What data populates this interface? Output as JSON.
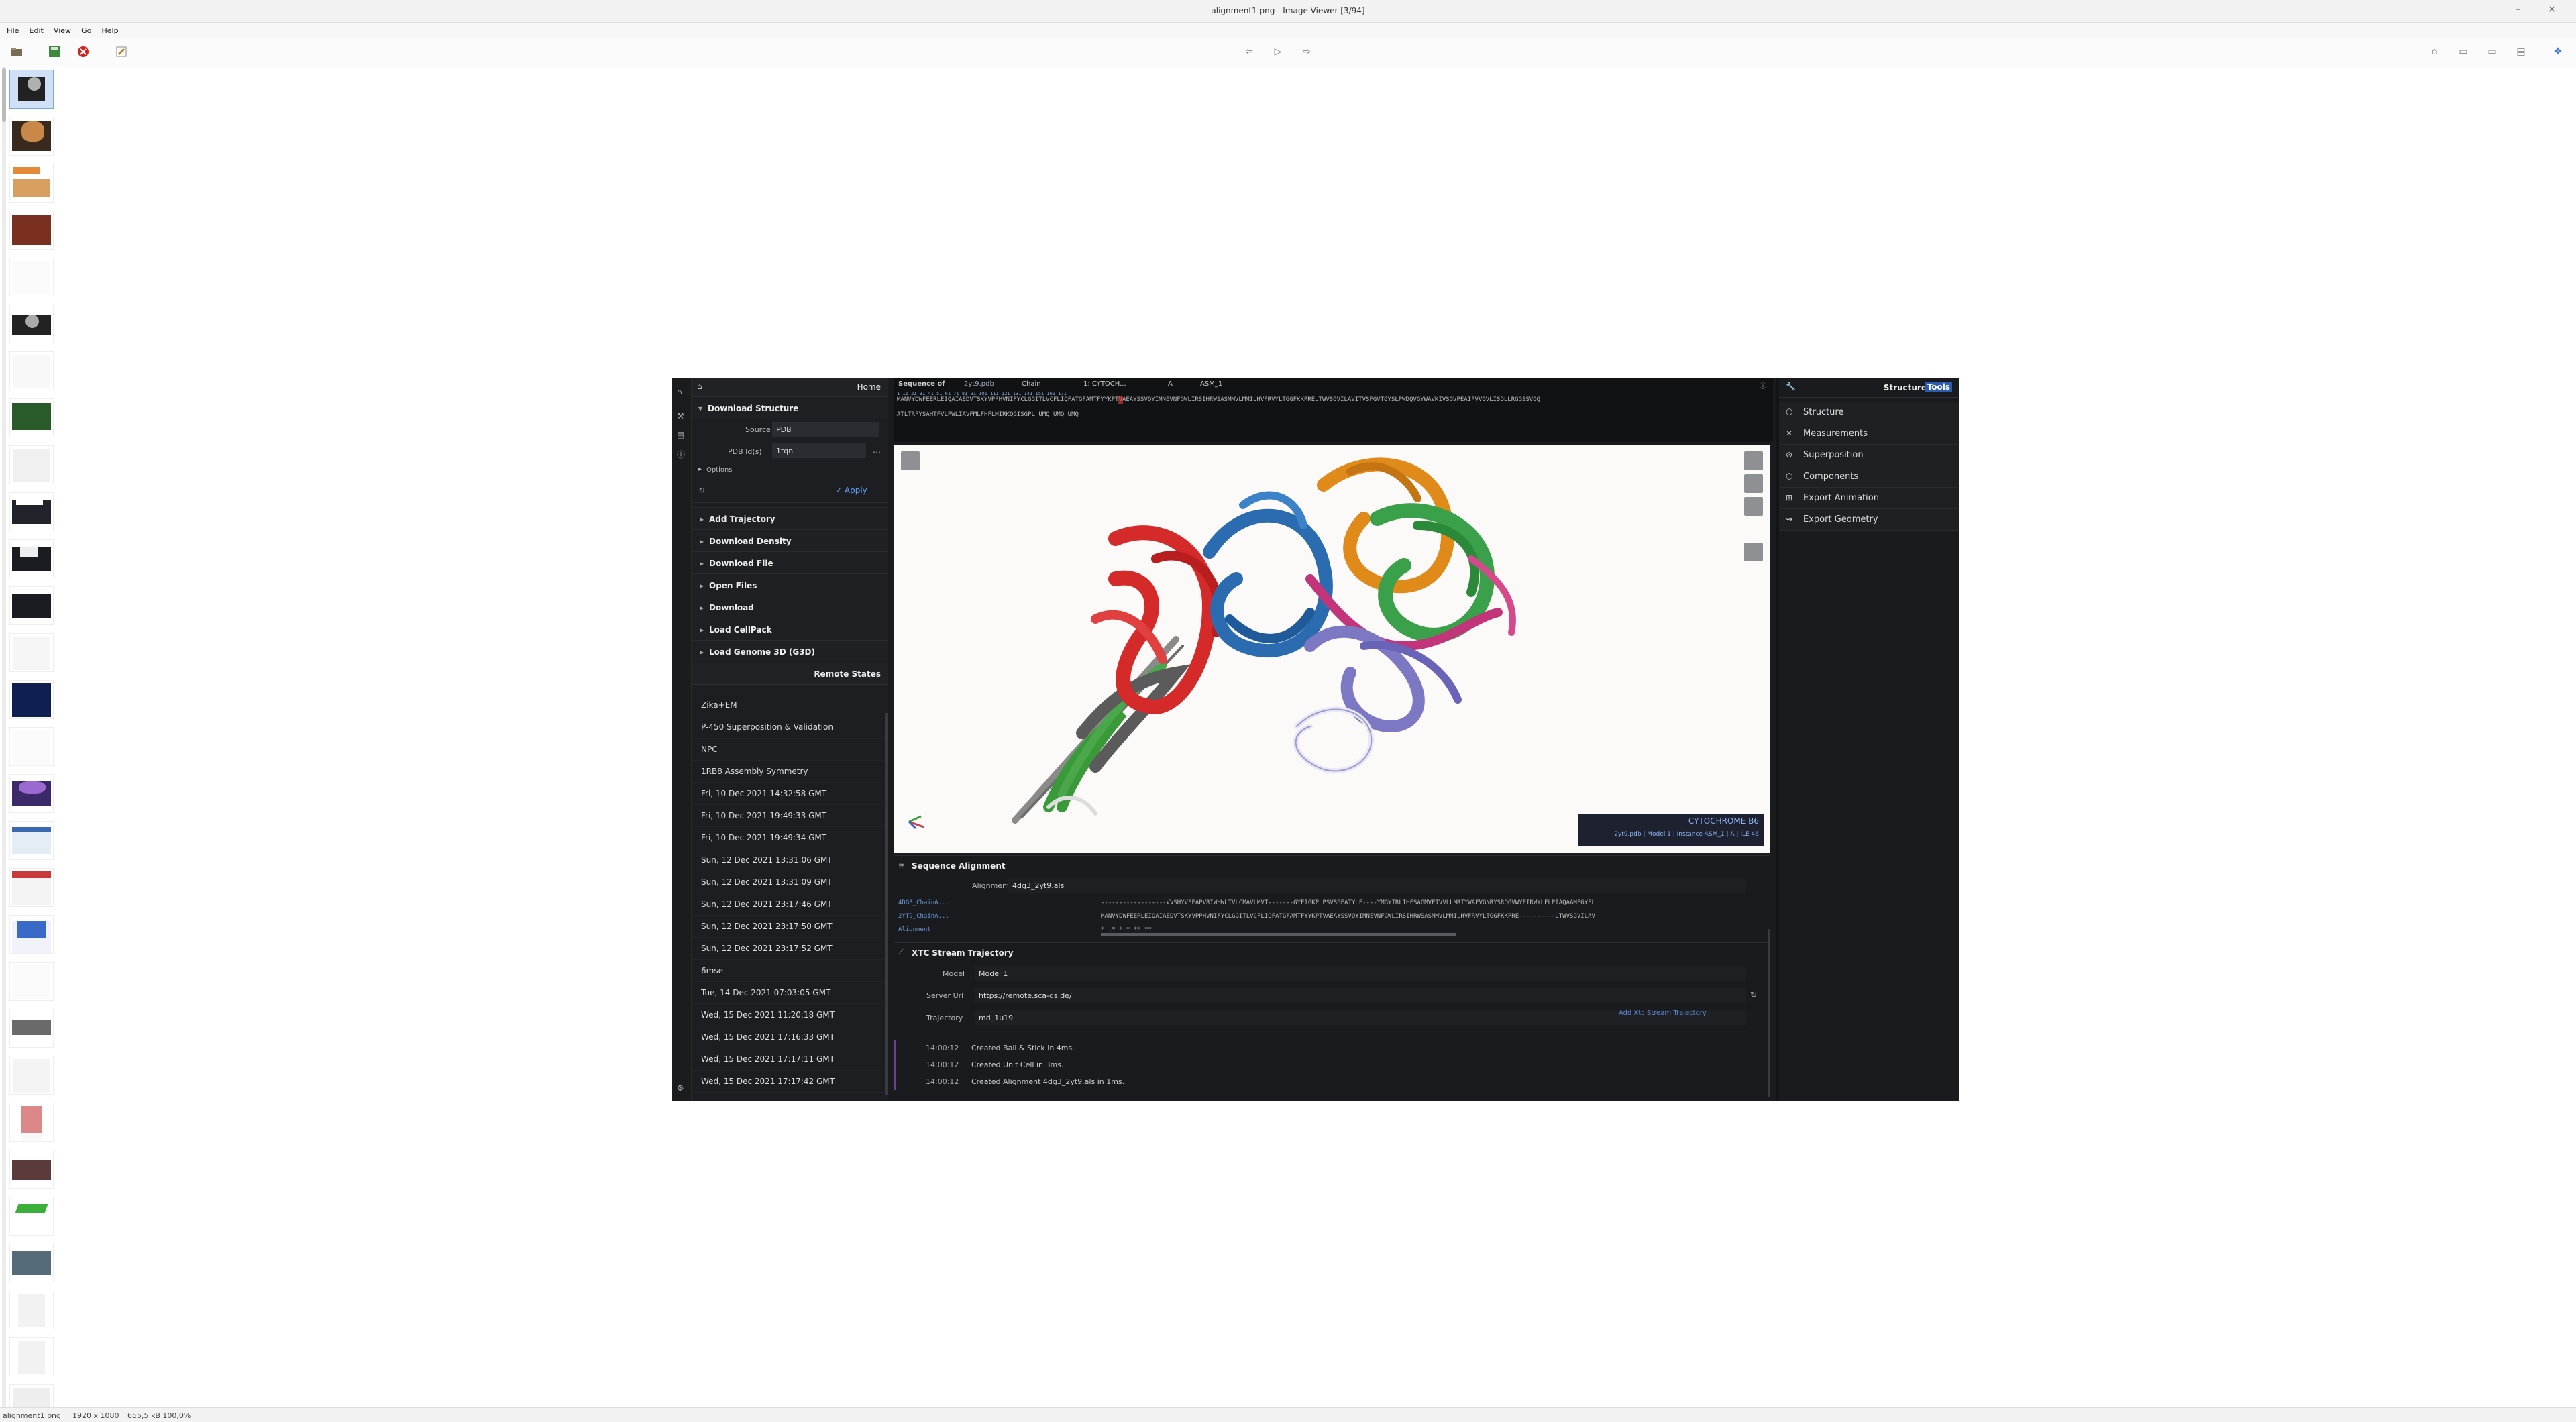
{
  "window": {
    "title": "alignment1.png - Image Viewer [3/94]",
    "minimize": "–",
    "close": "×"
  },
  "menu": [
    "File",
    "Edit",
    "View",
    "Go",
    "Help"
  ],
  "status": {
    "filename": "alignment1.png",
    "dimensions": "1920 x 1080",
    "size_zoom": "655,5 kB  100,0%"
  },
  "app": {
    "left": {
      "home_title": "Home",
      "download_structure": {
        "title": "Download Structure",
        "source_label": "Source",
        "source_value": "PDB",
        "pdbid_label": "PDB Id(s)",
        "pdbid_value": "1tqn",
        "options_label": "Options",
        "apply_label": "Apply"
      },
      "actions": [
        "Add Trajectory",
        "Download Density",
        "Download File",
        "Open Files",
        "Download",
        "Load CellPack",
        "Load Genome 3D (G3D)"
      ],
      "remote_title": "Remote States",
      "remote_states": [
        "Zika+EM",
        "P-450 Superposition & Validation",
        "NPC",
        "1RB8 Assembly Symmetry",
        "Fri, 10 Dec 2021 14:32:58 GMT",
        "Fri, 10 Dec 2021 19:49:33 GMT",
        "Fri, 10 Dec 2021 19:49:34 GMT",
        "Sun, 12 Dec 2021 13:31:06 GMT",
        "Sun, 12 Dec 2021 13:31:09 GMT",
        "Sun, 12 Dec 2021 23:17:46 GMT",
        "Sun, 12 Dec 2021 23:17:50 GMT",
        "Sun, 12 Dec 2021 23:17:52 GMT",
        "6mse",
        "Tue, 14 Dec 2021 07:03:05 GMT",
        "Wed, 15 Dec 2021 11:20:18 GMT",
        "Wed, 15 Dec 2021 17:16:33 GMT",
        "Wed, 15 Dec 2021 17:17:11 GMT",
        "Wed, 15 Dec 2021 17:17:42 GMT"
      ]
    },
    "sequence_header": {
      "label": "Sequence of",
      "file": "2yt9.pdb",
      "chain_label": "Chain",
      "chain_value": "1: CYTOCH...",
      "chain_id": "A",
      "asm": "ASM_1",
      "line1": "MANVYDWFEERLEIQAIAEDVTSKYVPPHVNIFYCLGGITLVCFLIQFATGFAMTFYYKPTVAEAYSSVQYIMNEVNFGWLIRSIHRWSASMMVLMMILHVFRVYLTGGFKKPRELTWVSGVILAVITVSFGVTGYSLPWDQVGYWAVKIVSGVPEAIPVVGVLISDLLRGGSSVGQ",
      "line2": "ATLTRFYSAHTFVLPWLIAVFMLFHFLMIRKQGISGPL UMQ UMQ UMQ",
      "numbers": "1          11          21          31          41          51          61          71          81          91         101         111         121         131         141         151         161         171"
    },
    "viewer": {
      "info_title": "CYTOCHROME B6",
      "info_detail": "2yt9.pdb | Model 1 | Instance ASM_1 | A | ILE 46"
    },
    "sequence_alignment": {
      "title": "Sequence Alignment",
      "alignment_label": "Alignment",
      "alignment_value": "4dg3_2yt9.als",
      "rows": [
        {
          "name": "4DG3_ChainA...",
          "seq": "------------------VVSHYVFEAPVRIWHWLTVLCMAVLMVT-------GYFIGKPLPSVSGEATYLF----YMGYIRLIHFSAGMVFTVVLLMRIYWAFVGNRYSRQGVWYFIRWYLFLPIAQAAMFGYFL"
        },
        {
          "name": "2YT9_ChainA...",
          "seq": "MANVYDWFEERLEIQAIAEDVTSKYVPPHVNIFYCLGGITLVCFLIQFATGFAMTFYYKPTVAEAYSSVQYIMNEVNFGWLIRSIHRWSASMMVLMMILHVFRVYLTGGFKKPRE----------LTWVSGVILAV"
        },
        {
          "name": "Alignment",
          "seq": "          *      .*    *                                               *          ** **"
        }
      ]
    },
    "xtc": {
      "title": "XTC Stream Trajectory",
      "model_label": "Model",
      "model_value": "Model 1",
      "server_label": "Server Url",
      "server_value": "https://remote.sca-ds.de/",
      "traj_label": "Trajectory",
      "traj_value": "md_1u19",
      "add_link": "Add Xtc Stream Trajectory"
    },
    "log": [
      {
        "time": "14:00:12",
        "msg": "Created Ball & Stick in 4ms."
      },
      {
        "time": "14:00:12",
        "msg": "Created Unit Cell in 3ms."
      },
      {
        "time": "14:00:12",
        "msg": "Created Alignment 4dg3_2yt9.als in 1ms."
      }
    ],
    "right": {
      "title": "Structure",
      "title_hl": "Tools",
      "tools": [
        {
          "icon": "structure-icon",
          "label": "Structure"
        },
        {
          "icon": "ruler-icon",
          "label": "Measurements"
        },
        {
          "icon": "superposition-icon",
          "label": "Superposition"
        },
        {
          "icon": "components-icon",
          "label": "Components"
        },
        {
          "icon": "export-animation-icon",
          "label": "Export Animation"
        },
        {
          "icon": "export-geometry-icon",
          "label": "Export Geometry"
        }
      ]
    }
  },
  "colors": {
    "accent": "#5aa0f0",
    "chain_red": "#d42a2a",
    "chain_blue": "#2b6cb0",
    "chain_orange": "#e08a1a",
    "chain_green": "#3a9a3a",
    "chain_pink": "#c2357a",
    "chain_lavender": "#7d78c4",
    "chain_gray": "#8a8a8a"
  }
}
